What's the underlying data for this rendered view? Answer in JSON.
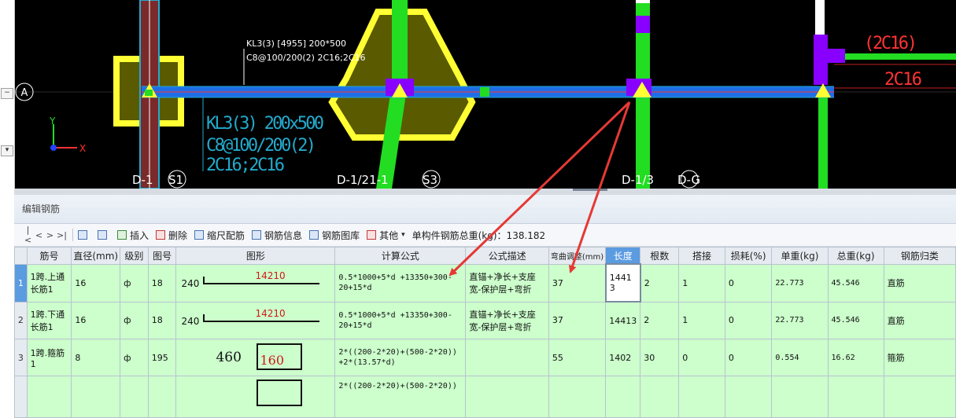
{
  "cad": {
    "axis_label": "A",
    "axis_y": "Y",
    "axis_x": "X",
    "beam_label_small_1": "KL3(3) [4955] 200*500",
    "beam_label_small_2": "C8@100/200(2) 2C16;2C16",
    "beam_label_large_1": "KL3(3) 200x500",
    "beam_label_large_2": "C8@100/200(2)",
    "beam_label_large_3": "2C16;2C16",
    "right_label_1": "(2C16)",
    "right_label_2": "2C16",
    "grid_labels": [
      "D-1",
      "S1",
      "D-1/21-1",
      "S3",
      "D-1/3",
      "D-G"
    ],
    "colors": {
      "beam": "#1e6ee8",
      "column": "#ffff33",
      "rebar": "#22dd22",
      "support": "#8800ff",
      "text": "#ffffff",
      "cyan": "#22aacc",
      "red_text": "#ff3333"
    }
  },
  "panel": {
    "title": "编辑钢筋",
    "toolbar": {
      "nav": [
        "|<",
        "<",
        ">",
        ">|"
      ],
      "insert": "插入",
      "delete": "删除",
      "scale": "缩尺配筋",
      "info": "钢筋信息",
      "library": "钢筋图库",
      "other": "其他",
      "weight": "单构件钢筋总重(kg)：138.182"
    },
    "columns": [
      "筋号",
      "直径(mm)",
      "级别",
      "图号",
      "图形",
      "计算公式",
      "公式描述",
      "弯曲调整(mm)",
      "长度",
      "根数",
      "搭接",
      "损耗(%)",
      "单重(kg)",
      "总重(kg)",
      "钢筋归类"
    ],
    "rows": [
      {
        "no": "1",
        "name": "1跨.上通长筋1",
        "dia": "16",
        "grade": "ф",
        "fig": "18",
        "shape_left": "240",
        "shape_mid": "14210",
        "formula": "0.5*1000+5*d +13350+300-20+15*d",
        "desc": "直锚+净长+支座宽-保护层+弯折",
        "bend": "37",
        "length": "14413",
        "count": "2",
        "lap": "1",
        "loss": "0",
        "unit": "22.773",
        "total": "45.546",
        "cat": "直筋"
      },
      {
        "no": "2",
        "name": "1跨.下通长筋1",
        "dia": "16",
        "grade": "ф",
        "fig": "18",
        "shape_left": "240",
        "shape_mid": "14210",
        "formula": "0.5*1000+5*d +13350+300-20+15*d",
        "desc": "直锚+净长+支座宽-保护层+弯折",
        "bend": "37",
        "length": "14413",
        "count": "2",
        "lap": "1",
        "loss": "0",
        "unit": "22.773",
        "total": "45.546",
        "cat": "直筋"
      },
      {
        "no": "3",
        "name": "1跨.箍筋1",
        "dia": "8",
        "grade": "ф",
        "fig": "195",
        "shape_left": "460",
        "shape_mid": "160",
        "formula": "2*((200-2*20)+(500-2*20)) +2*(13.57*d)",
        "desc": "",
        "bend": "55",
        "length": "1402",
        "count": "30",
        "lap": "0",
        "loss": "0",
        "unit": "0.554",
        "total": "16.62",
        "cat": "箍筋"
      }
    ],
    "partial_row_formula": "2*((200-2*20)+(500-2*20))"
  }
}
